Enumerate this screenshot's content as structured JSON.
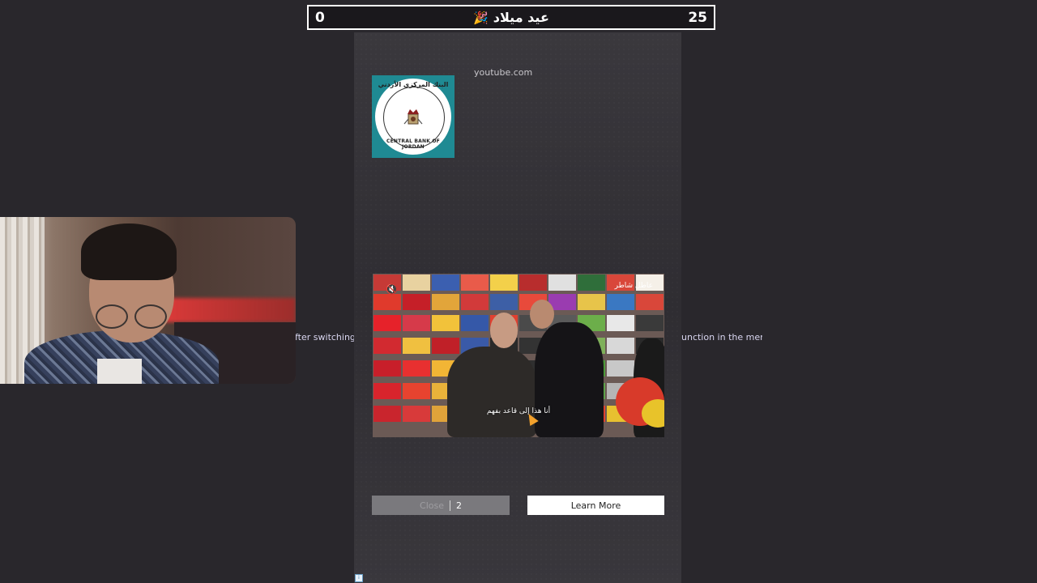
{
  "scorebar": {
    "left_score": "0",
    "title": "عيد ميلاد",
    "party_icon": "🎉",
    "right_score": "25"
  },
  "side_text": {
    "left": "fter switching th",
    "right": "unction in the menu!"
  },
  "ad": {
    "domain": "youtube.com",
    "logo": {
      "seal_top_text": "البنك المركزي الأردني",
      "seal_bottom_text": "CENTRAL BANK OF JORDAN"
    },
    "video": {
      "subtitle": "أنا هذا إلى قاعد بفهم",
      "corner_text": "عاطل شاطر"
    },
    "close_label": "Close",
    "close_countdown": "2",
    "learn_more_label": "Learn More",
    "adchoices_icon": "i"
  },
  "colors": {
    "background": "#29272c",
    "panel": "#343237",
    "logo_bg": "#1f8a93"
  }
}
